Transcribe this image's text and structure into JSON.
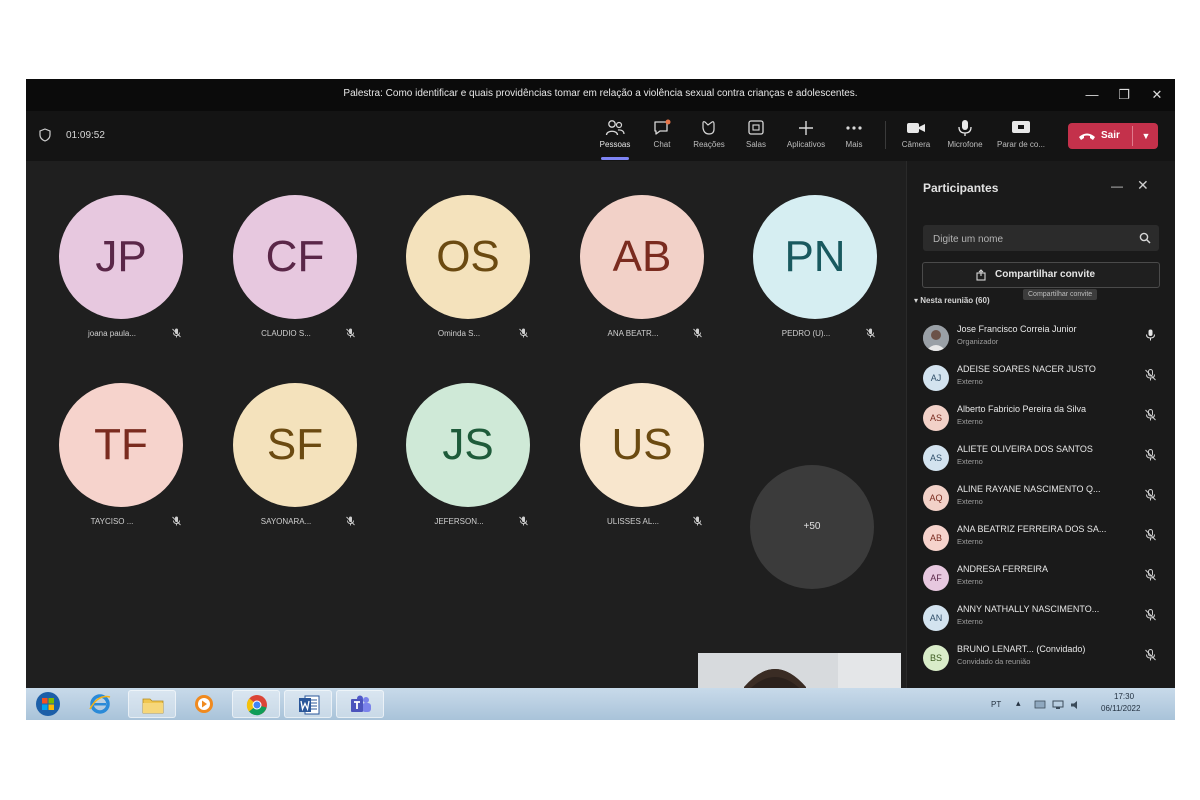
{
  "window": {
    "title": "Palestra: Como identificar e quais providências tomar em relação a violência sexual contra crianças e adolescentes.",
    "controls": [
      "minimize-icon",
      "restore-icon",
      "close-icon"
    ]
  },
  "toolbar": {
    "timer": "01:09:52",
    "buttons": [
      {
        "icon": "people-icon",
        "label": "Pessoas",
        "active": true
      },
      {
        "icon": "chat-icon",
        "label": "Chat"
      },
      {
        "icon": "reactions-icon",
        "label": "Reações"
      },
      {
        "icon": "rooms-icon",
        "label": "Salas"
      },
      {
        "icon": "apps-plus-icon",
        "label": "Aplicativos"
      },
      {
        "icon": "more-icon",
        "label": "Mais"
      },
      {
        "icon": "camera-icon",
        "label": "Câmera"
      },
      {
        "icon": "microphone-icon",
        "label": "Microfone"
      },
      {
        "icon": "share-screen-icon",
        "label": "Parar de co..."
      }
    ],
    "leave_label": "Sair",
    "colors": {
      "leave": "#c4314b",
      "active_underline": "#7f85f5"
    }
  },
  "stage": {
    "tiles": [
      {
        "initials": "JP",
        "name": "joana paula...",
        "bg": "#e7c8df",
        "fg": "#5a2748"
      },
      {
        "initials": "CF",
        "name": "CLAUDIO S...",
        "bg": "#e7c8df",
        "fg": "#5a2748"
      },
      {
        "initials": "OS",
        "name": "Ominda S...",
        "bg": "#f4e2bc",
        "fg": "#6b4a11"
      },
      {
        "initials": "AB",
        "name": "ANA BEATR...",
        "bg": "#f2d1c8",
        "fg": "#7a2b1f"
      },
      {
        "initials": "PN",
        "name": "PEDRO (U)...",
        "bg": "#d6eef2",
        "fg": "#19595f"
      },
      {
        "initials": "TF",
        "name": "TAYCISO ...",
        "bg": "#f6d3cc",
        "fg": "#7a2b1f"
      },
      {
        "initials": "SF",
        "name": "SAYONARA...",
        "bg": "#f4e2bc",
        "fg": "#6b4a11"
      },
      {
        "initials": "JS",
        "name": "JEFERSON...",
        "bg": "#cfe9d7",
        "fg": "#1e5b3a"
      },
      {
        "initials": "US",
        "name": "ULISSES AL...",
        "bg": "#f8e6cd",
        "fg": "#6b4a11"
      }
    ],
    "overflow_label": "+50"
  },
  "panel": {
    "title": "Participantes",
    "search_placeholder": "Digite um nome",
    "share_invite_label": "Compartilhar convite",
    "tooltip": "Compartilhar convite",
    "section_label": "Nesta reunião (60)",
    "participants": [
      {
        "initials": "",
        "name": "Jose Francisco Correia Junior",
        "role": "Organizador",
        "photo": true,
        "bg": "#8d8d8d",
        "fg": "#ffffff",
        "mic_muted": false
      },
      {
        "initials": "AJ",
        "name": "ADEISE SOARES NACER JUSTO",
        "role": "Externo",
        "bg": "#d3e3ef",
        "fg": "#32506a",
        "mic_muted": true
      },
      {
        "initials": "AS",
        "name": "Alberto Fabricio Pereira da Silva",
        "role": "Externo",
        "bg": "#f2d1c8",
        "fg": "#7a2b1f",
        "mic_muted": true
      },
      {
        "initials": "AS",
        "name": "ALIETE OLIVEIRA DOS SANTOS",
        "role": "Externo",
        "bg": "#d3e3ef",
        "fg": "#32506a",
        "mic_muted": true
      },
      {
        "initials": "AQ",
        "name": "ALINE RAYANE NASCIMENTO Q...",
        "role": "Externo",
        "bg": "#f2d1c8",
        "fg": "#7a2b1f",
        "mic_muted": true
      },
      {
        "initials": "AB",
        "name": "ANA BEATRIZ FERREIRA DOS SA...",
        "role": "Externo",
        "bg": "#f6d3cc",
        "fg": "#7a2b1f",
        "mic_muted": true
      },
      {
        "initials": "AF",
        "name": "ANDRESA FERREIRA",
        "role": "Externo",
        "bg": "#e7c8df",
        "fg": "#5a2748",
        "mic_muted": true
      },
      {
        "initials": "AN",
        "name": "ANNY NATHALLY NASCIMENTO...",
        "role": "Externo",
        "bg": "#d3e3ef",
        "fg": "#32506a",
        "mic_muted": true
      },
      {
        "initials": "BS",
        "name": "BRUNO LENART...  (Convidado)",
        "role": "Convidado da reunião",
        "bg": "#d9ecc9",
        "fg": "#3b5a1f",
        "mic_muted": true
      }
    ]
  },
  "taskbar": {
    "apps": [
      "windows-start-icon",
      "internet-explorer-icon",
      "file-explorer-icon",
      "media-player-icon",
      "chrome-icon",
      "word-icon",
      "teams-icon"
    ],
    "language": "PT",
    "time": "17:30",
    "date": "06/11/2022"
  }
}
